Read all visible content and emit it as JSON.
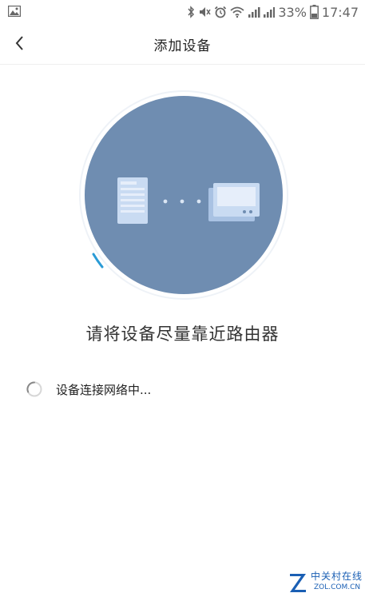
{
  "status_bar": {
    "battery_percent": "33%",
    "time": "17:47",
    "icons": [
      "gallery-icon",
      "bluetooth-icon",
      "mute-icon",
      "alarm-icon",
      "wifi-icon",
      "signal-icon-1",
      "signal-icon-2",
      "battery-icon"
    ]
  },
  "header": {
    "back_icon": "chevron-left-icon",
    "title": "添加设备"
  },
  "illustration": {
    "circle_color": "#6f8db1",
    "accent_color": "#2a9bd6",
    "dots": "· · ·"
  },
  "main": {
    "prompt": "请将设备尽量靠近路由器",
    "status_text": "设备连接网络中..."
  },
  "watermark": {
    "cn": "中关村在线",
    "en": "ZOL.COM.CN"
  }
}
